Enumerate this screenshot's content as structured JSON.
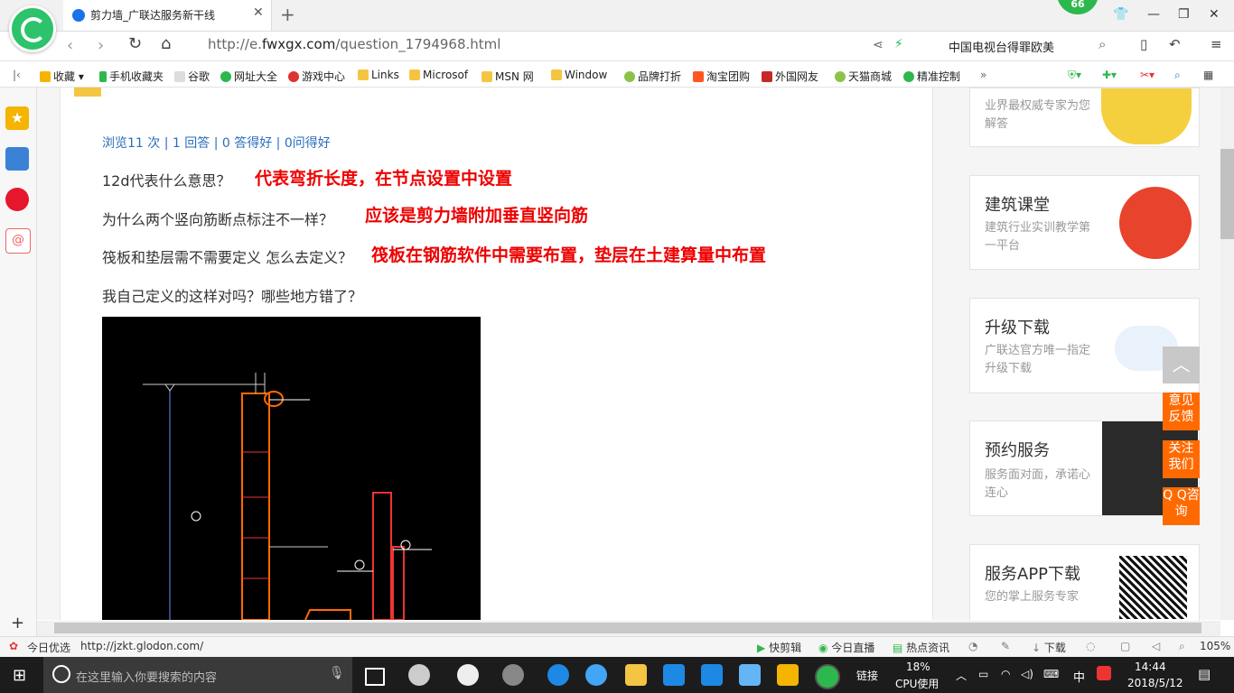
{
  "browser": {
    "tab_title": "剪力墙_广联达服务新干线",
    "badge": "66",
    "url_prefix": "http://e.",
    "url_domain": "fwxgx.com",
    "url_path": "/question_1794968.html",
    "hot_search": "中国电视台得罪欧美"
  },
  "bookmarks": [
    "收藏",
    "手机收藏夹",
    "谷歌",
    "网址大全",
    "游戏中心",
    "Links",
    "Microsof",
    "MSN 网",
    "Window",
    "品牌打折",
    "淘宝团购",
    "外国网友",
    "天猫商城",
    "精准控制"
  ],
  "question": {
    "stats": "浏览11 次 | 1 回答 | 0 答得好 | 0问得好",
    "q1": "12d代表什么意思？",
    "a1": "代表弯折长度，在节点设置中设置",
    "q2": "为什么两个竖向筋断点标注不一样？",
    "a2": "应该是剪力墙附加垂直竖向筋",
    "q3": "筏板和垫层需不需要定义 怎么去定义？",
    "a3": "筏板在钢筋软件中需要布置，垫层在土建算量中布置",
    "q4": "我自己定义的这样对吗？哪些地方错了？"
  },
  "ads": [
    {
      "title": "",
      "sub": "业界最权威专家为您解答"
    },
    {
      "title": "建筑课堂",
      "sub": "建筑行业实训教学第一平台"
    },
    {
      "title": "升级下载",
      "sub": "广联达官方唯一指定升级下载"
    },
    {
      "title": "预约服务",
      "sub": "服务面对面，承诺心连心"
    },
    {
      "title": "服务APP下载",
      "sub": "您的掌上服务专家"
    }
  ],
  "float_buttons": {
    "feedback": "意见反馈",
    "follow": "关注我们",
    "qq": "Q Q咨询"
  },
  "statusbar": {
    "left_label": "今日优选",
    "link": "http://jzkt.glodon.com/",
    "items": [
      "快剪辑",
      "今日直播",
      "热点资讯",
      "下载"
    ],
    "zoom": "105%"
  },
  "taskbar": {
    "search_placeholder": "在这里输入你要搜索的内容",
    "link_label": "链接",
    "cpu_percent": "18%",
    "cpu_label": "CPU使用",
    "ime": "中",
    "time": "14:44",
    "date": "2018/5/12"
  }
}
